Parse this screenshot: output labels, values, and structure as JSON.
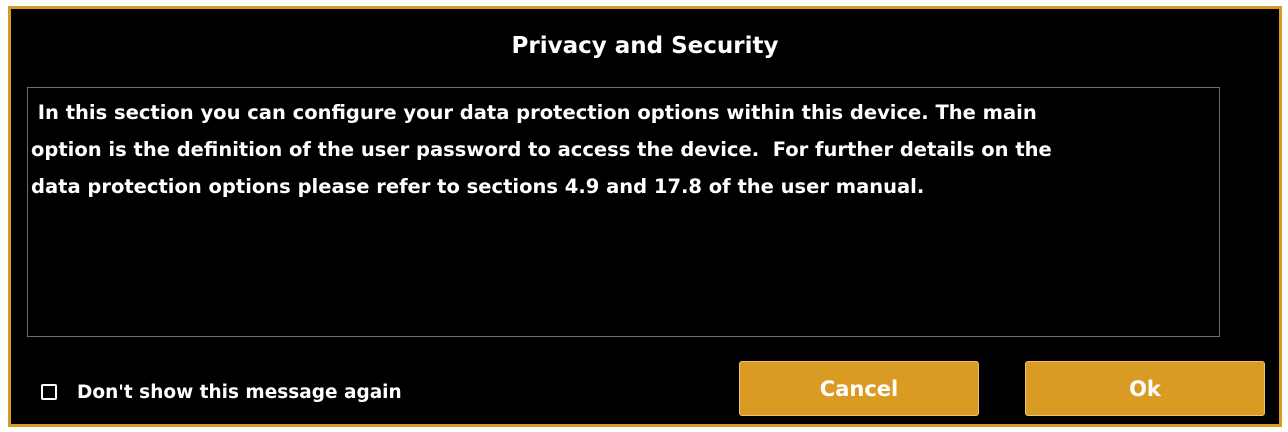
{
  "dialog": {
    "title": "Privacy and Security",
    "message": " In this section you can configure your data protection options within this device. The main\noption is the definition of the user password to access the device.  For further details on the\ndata protection options please refer to sections 4.9 and 17.8 of the user manual.",
    "checkbox": {
      "label": "Don't show this message again",
      "checked": false
    },
    "buttons": {
      "cancel_label": "Cancel",
      "ok_label": "Ok"
    }
  },
  "colors": {
    "background": "#000000",
    "accent": "#da9b24",
    "border": "#d99a24",
    "text": "#ffffff"
  }
}
